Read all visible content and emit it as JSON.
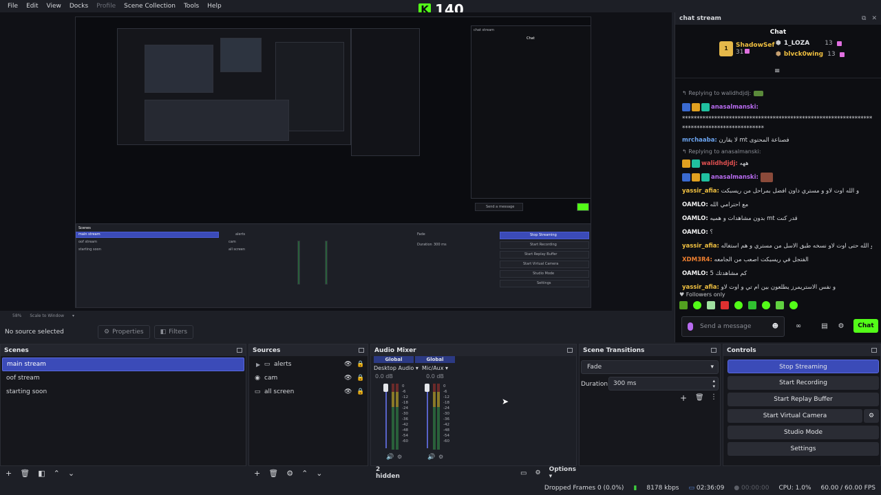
{
  "menu": {
    "items": [
      "File",
      "Edit",
      "View",
      "Docks",
      "Profile",
      "Scene Collection",
      "Tools",
      "Help"
    ]
  },
  "kick_counter": {
    "logo": "K",
    "count": "140"
  },
  "preview": {
    "mirror_lines": [
      "main stream",
      "oof stream",
      "starting soon",
      "alerts",
      "cam",
      "all screen",
      "Stop Streaming",
      "Start Recording",
      "Start Replay Buffer",
      "Start Virtual Camera",
      "Studio Mode",
      "Settings",
      "Fade",
      "Duration",
      "300 ms",
      "chat stream",
      "Chat",
      "Send a message",
      "Chat"
    ]
  },
  "zoom": {
    "percent": "58%",
    "scale_mode": "Scale to Window"
  },
  "source_bar": {
    "no_source": "No source selected",
    "properties": "Properties",
    "filters": "Filters"
  },
  "chat_dock": {
    "dock_title": "chat stream",
    "title": "Chat",
    "leaderboard": [
      {
        "name": "ShadowSef",
        "count": "31",
        "rank": "1"
      },
      {
        "name": "1_LOZA",
        "count": "13"
      },
      {
        "name": "blvck0wing",
        "count": "13"
      }
    ],
    "messages": [
      {
        "reply": "Replying to walidhdjdj:"
      },
      {
        "user": "anasalmanski:",
        "text": "",
        "color": "#b86bf0"
      },
      {
        "text": "*************************************************************************"
      },
      {
        "text": "****************************"
      },
      {
        "user": "mrchaaba:",
        "text": "لا يقارن mt فصناعة المحتوى",
        "color": "#6ba4f0"
      },
      {
        "reply": "Replying to anasalmanski:"
      },
      {
        "user": "walidhdjdj:",
        "text": "ههه",
        "color": "#e05050"
      },
      {
        "user": "anasalmanski:",
        "text": "",
        "color": "#b86bf0"
      },
      {
        "user": "yassir_afia:",
        "text": "و الله اوت لاو و مستري داون افضل بمراحل من ريسبكت",
        "color": "#f0c040"
      },
      {
        "user": "OAMLO:",
        "text": "مع احترامي الله",
        "color": "#f0f0f0"
      },
      {
        "user": "OAMLO:",
        "text": "بدون مشاهدات و هميه mt قدر كنت",
        "color": "#f0f0f0"
      },
      {
        "user": "OAMLO:",
        "text": "؟",
        "color": "#f0f0f0"
      },
      {
        "user": "yassir_afia:",
        "text": "و الله حتى اوت لاو نسخه طبق الاسل من مستري و هم استغاله",
        "color": "#f0c040"
      },
      {
        "user": "XDM3R4:",
        "text": "الفتجل في ريسبكت اصعب من الجامعه",
        "color": "#f08030"
      },
      {
        "user": "OAMLO:",
        "text": "كم مشاهدتك 5",
        "color": "#f0f0f0"
      },
      {
        "user": "yassir_afia:",
        "text": "و نفس الاستريمرز يطلعون بين ام تي و اوت لاو",
        "color": "#f0c040"
      }
    ],
    "followers_only": "Followers only",
    "input_placeholder": "Send a message",
    "send_label": "Chat"
  },
  "scenes": {
    "title": "Scenes",
    "items": [
      "main stream",
      "oof stream",
      "starting soon"
    ],
    "selected": "main stream"
  },
  "sources": {
    "title": "Sources",
    "items": [
      "alerts",
      "cam",
      "all screen"
    ]
  },
  "audio_mixer": {
    "title": "Audio Mixer",
    "channels": [
      {
        "global": "Global",
        "device": "Desktop Audio",
        "db": "0.0 dB"
      },
      {
        "global": "Global",
        "device": "Mic/Aux",
        "db": "0.0 dB"
      }
    ],
    "scale": [
      "0",
      "-6",
      "-12",
      "-18",
      "-24",
      "-30",
      "-36",
      "-42",
      "-48",
      "-54",
      "-60"
    ],
    "hidden": "2 hidden",
    "options": "Options"
  },
  "scene_transitions": {
    "title": "Scene Transitions",
    "transition": "Fade",
    "duration_label": "Duration",
    "duration_value": "300 ms"
  },
  "controls": {
    "title": "Controls",
    "buttons": [
      "Stop Streaming",
      "Start Recording",
      "Start Replay Buffer",
      "Start Virtual Camera",
      "Studio Mode",
      "Settings"
    ]
  },
  "status": {
    "dropped_frames": "Dropped Frames 0 (0.0%)",
    "bitrate": "8178 kbps",
    "stream_time": "02:36:09",
    "record_time": "00:00:00",
    "cpu": "CPU: 1.0%",
    "fps": "60.00 / 60.00 FPS"
  },
  "colors": {
    "accent": "#3b4bb8",
    "kick_green": "#53fc18",
    "panel": "#1d1f26"
  }
}
